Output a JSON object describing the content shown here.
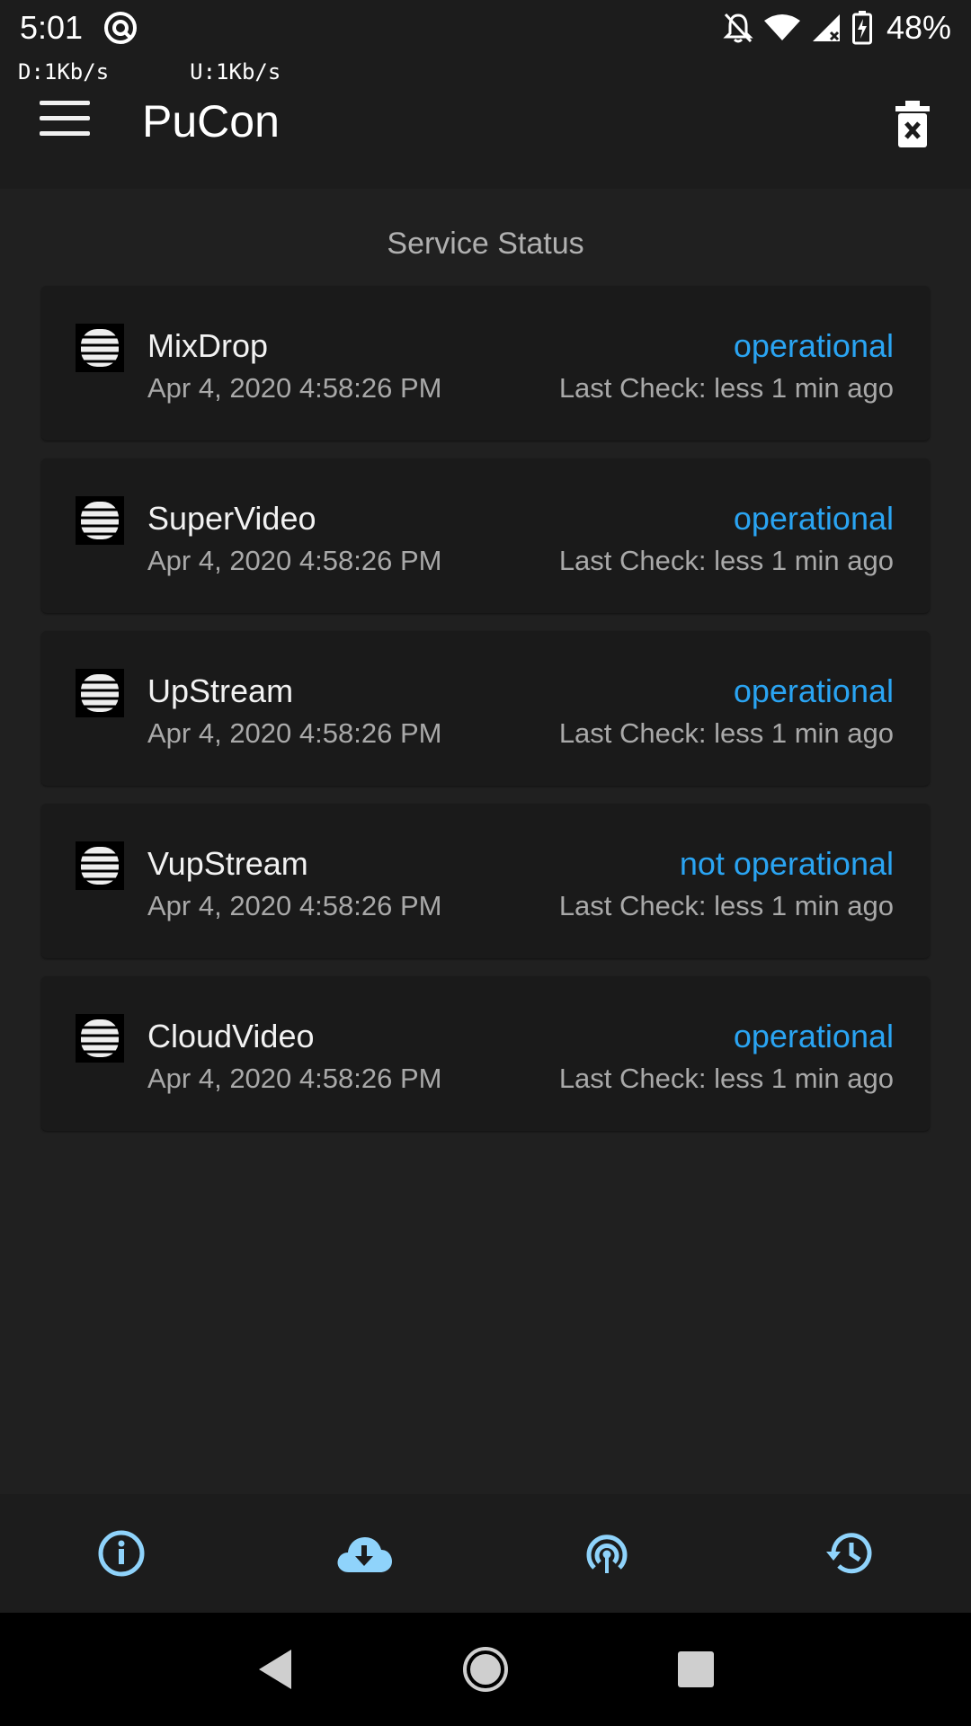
{
  "status_bar": {
    "time": "5:01",
    "battery": "48%",
    "icons": [
      "vpn-icon",
      "notifications-off-icon",
      "wifi-icon",
      "cell-signal-icon",
      "battery-charging-icon"
    ]
  },
  "app_bar": {
    "download_speed": "D:1Kb/s",
    "upload_speed": "U:1Kb/s",
    "title": "PuCon",
    "icons": [
      "menu-icon",
      "delete-icon"
    ]
  },
  "main": {
    "section_title": "Service Status",
    "services": [
      {
        "name": "MixDrop",
        "date": "Apr 4, 2020 4:58:26 PM",
        "status": "operational",
        "last_check": "Last Check: less 1 min ago"
      },
      {
        "name": "SuperVideo",
        "date": "Apr 4, 2020 4:58:26 PM",
        "status": "operational",
        "last_check": "Last Check: less 1 min ago"
      },
      {
        "name": "UpStream",
        "date": "Apr 4, 2020 4:58:26 PM",
        "status": "operational",
        "last_check": "Last Check: less 1 min ago"
      },
      {
        "name": "VupStream",
        "date": "Apr 4, 2020 4:58:26 PM",
        "status": "not operational",
        "last_check": "Last Check: less 1 min ago"
      },
      {
        "name": "CloudVideo",
        "date": "Apr 4, 2020 4:58:26 PM",
        "status": "operational",
        "last_check": "Last Check: less 1 min ago"
      }
    ]
  },
  "bottom_nav": {
    "items": [
      "info-icon",
      "cloud-download-icon",
      "broadcast-icon",
      "history-icon"
    ]
  },
  "system_nav": {
    "items": [
      "back-icon",
      "home-icon",
      "recents-icon"
    ]
  },
  "colors": {
    "accent": "#2aa4f2",
    "nav_icon": "#8fd3fb",
    "background": "#202020",
    "card": "#1a1a1a"
  }
}
